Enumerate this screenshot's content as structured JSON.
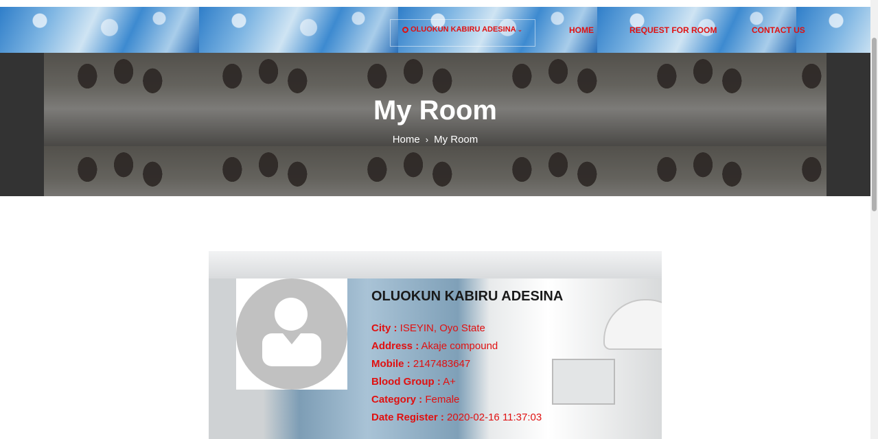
{
  "nav": {
    "user_name": "OLUOKUN KABIRU ADESINA",
    "items": [
      {
        "label": "HOME"
      },
      {
        "label": "REQUEST FOR ROOM"
      },
      {
        "label": "CONTACT US"
      }
    ]
  },
  "hero": {
    "title": "My Room",
    "breadcrumb": {
      "home": "Home",
      "current": "My Room"
    }
  },
  "profile": {
    "name": "OLUOKUN KABIRU ADESINA",
    "fields": [
      {
        "label": "City :",
        "value": "ISEYIN, Oyo State"
      },
      {
        "label": "Address :",
        "value": "Akaje compound"
      },
      {
        "label": "Mobile :",
        "value": "2147483647"
      },
      {
        "label": "Blood Group :",
        "value": "A+"
      },
      {
        "label": "Category :",
        "value": "Female"
      },
      {
        "label": "Date Register :",
        "value": "2020-02-16 11:37:03"
      }
    ]
  },
  "colors": {
    "accent": "#e01010",
    "hero_bg": "#333333"
  },
  "icons": {
    "user_menu": "user-icon",
    "dropdown": "chevron-down-icon",
    "breadcrumb_sep": "chevron-right-icon",
    "avatar": "avatar-placeholder-icon"
  }
}
